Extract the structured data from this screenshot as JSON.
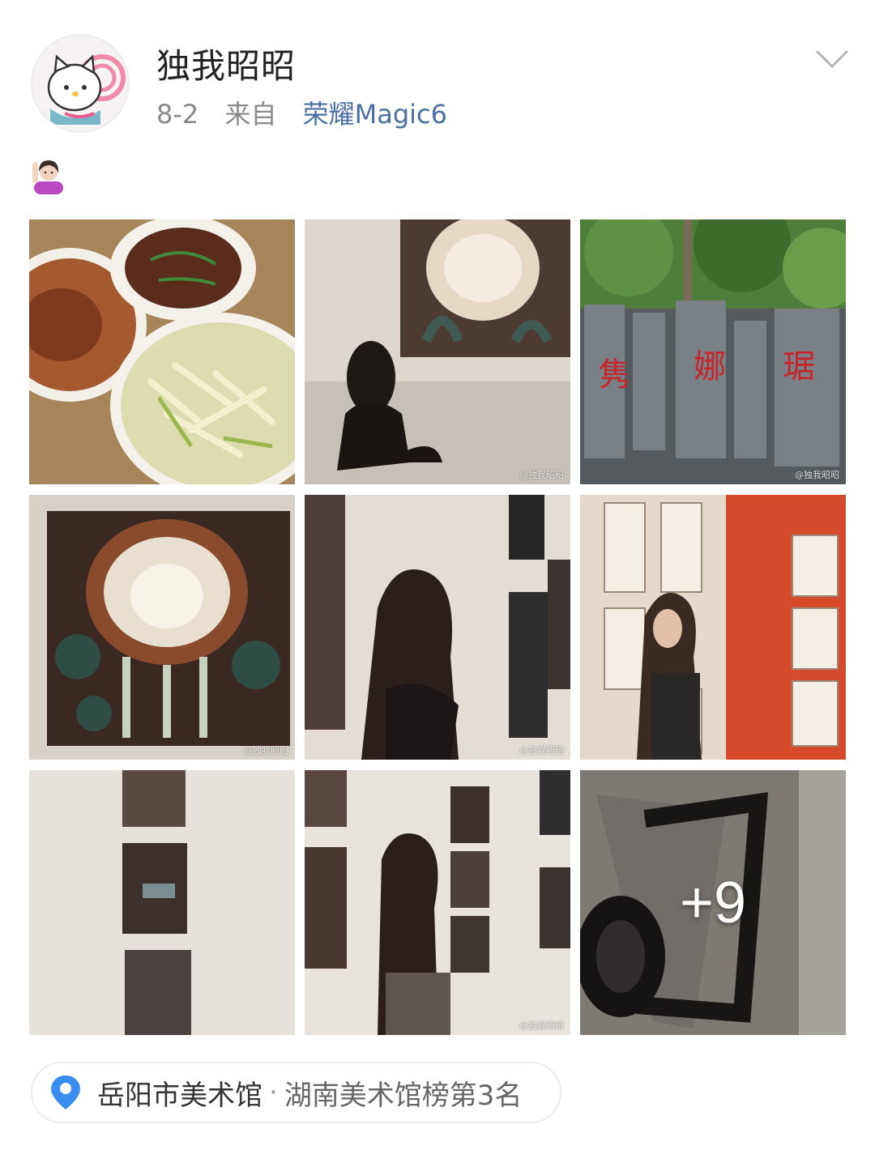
{
  "post": {
    "username": "独我昭昭",
    "date": "8-2",
    "source_prefix": "来自",
    "device": "荣耀Magic6",
    "emoji": "woman-raising-hand-icon"
  },
  "gallery": {
    "watermark": "@独我昭昭",
    "more_count": "+9",
    "tiles": [
      {
        "subject": "food-dishes"
      },
      {
        "subject": "girl-sitting-before-painting"
      },
      {
        "subject": "rockery-with-red-characters",
        "characters": [
          "隽",
          "娜",
          "琚"
        ]
      },
      {
        "subject": "ornate-painting"
      },
      {
        "subject": "girl-viewing-exhibit"
      },
      {
        "subject": "girl-posing-red-wall"
      },
      {
        "subject": "hanging-photos"
      },
      {
        "subject": "girl-viewing-photos"
      },
      {
        "subject": "abstract-ink-painting"
      }
    ]
  },
  "location": {
    "name": "岳阳市美术馆",
    "separator": "·",
    "rank": "湖南美术馆榜第3名",
    "icon": "location-pin-icon",
    "icon_color": "#3a8df0"
  },
  "colors": {
    "link": "#4a6fa3",
    "muted": "#8a8a8a"
  }
}
